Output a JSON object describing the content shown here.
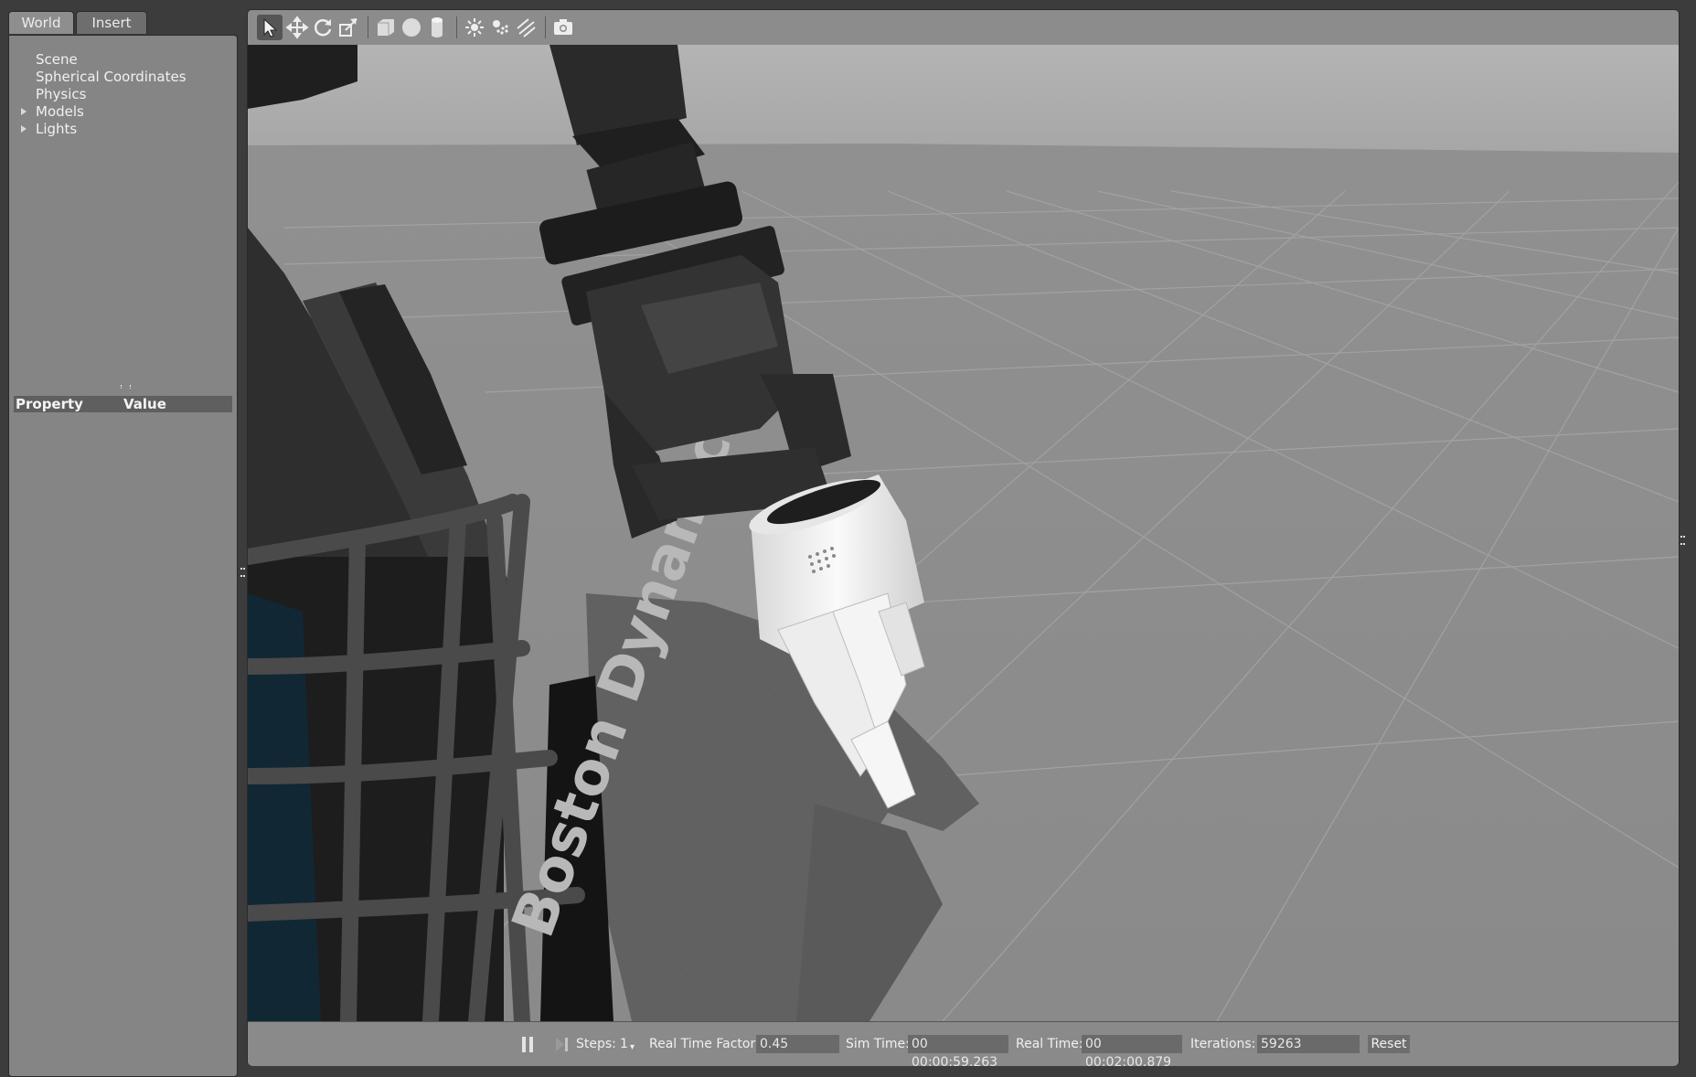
{
  "left_panel": {
    "tabs": [
      {
        "label": "World"
      },
      {
        "label": "Insert"
      }
    ],
    "tree": [
      {
        "label": "Scene",
        "expandable": false
      },
      {
        "label": "Spherical Coordinates",
        "expandable": false
      },
      {
        "label": "Physics",
        "expandable": false
      },
      {
        "label": "Models",
        "expandable": true
      },
      {
        "label": "Lights",
        "expandable": true
      }
    ],
    "property_table": {
      "col_property": "Property",
      "col_value": "Value"
    }
  },
  "toolbar": {
    "tools": [
      "select-mode-icon",
      "translate-icon",
      "rotate-icon",
      "scale-icon",
      "box-shape-icon",
      "sphere-shape-icon",
      "cylinder-shape-icon",
      "point-light-icon",
      "spot-light-icon",
      "directional-light-icon",
      "screenshot-icon"
    ],
    "active_tool": "select-mode-icon"
  },
  "statusbar": {
    "steps_label": "Steps:",
    "steps_value": "1",
    "rtf_label": "Real Time Factor:",
    "rtf_value": "0.45",
    "sim_time_label": "Sim Time:",
    "sim_time_value": "00 00:00:59.263",
    "real_time_label": "Real Time:",
    "real_time_value": "00 00:02:00.879",
    "iterations_label": "Iterations:",
    "iterations_value": "59263",
    "reset_label": "Reset"
  },
  "scene": {
    "robot_logo_text": "Boston Dynamics",
    "colors": {
      "sky": "#a9a9a9",
      "ground": "#8e8e8e",
      "robot_dark": "#2b2b2b",
      "gripper": "#f1f1f1"
    }
  }
}
